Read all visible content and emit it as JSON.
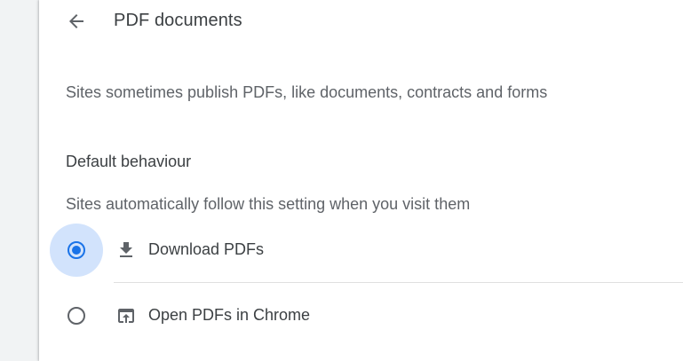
{
  "header": {
    "back_icon": "arrow-back-icon",
    "title": "PDF documents"
  },
  "intro": {
    "description": "Sites sometimes publish PDFs, like documents, contracts and forms"
  },
  "default_behaviour": {
    "heading": "Default behaviour",
    "description": "Sites automatically follow this setting when you visit them",
    "selected": "download",
    "options": [
      {
        "id": "download",
        "label": "Download PDFs",
        "icon": "download-icon",
        "checked": true
      },
      {
        "id": "open",
        "label": "Open PDFs in Chrome",
        "icon": "open-in-browser-icon",
        "checked": false
      }
    ]
  },
  "colors": {
    "accent": "#1a73e8",
    "ripple": "#d2e3fc",
    "text_primary": "#3c4043",
    "text_secondary": "#5f6368",
    "background": "#f1f3f4",
    "card": "#ffffff"
  }
}
